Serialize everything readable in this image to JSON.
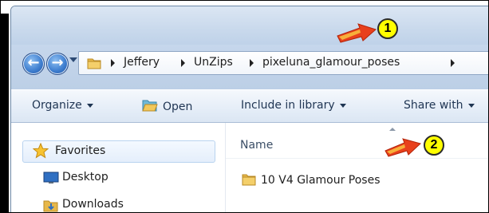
{
  "breadcrumb": {
    "items": [
      "Jeffery",
      "UnZips",
      "pixeluna_glamour_poses"
    ]
  },
  "toolbar": {
    "organize_label": "Organize",
    "open_label": "Open",
    "include_label": "Include in library",
    "share_label": "Share with"
  },
  "nav_pane": {
    "favorites_label": "Favorites",
    "items": [
      "Desktop",
      "Downloads"
    ]
  },
  "file_list": {
    "column_name": "Name",
    "rows": [
      "10 V4 Glamour Poses"
    ]
  },
  "annotations": {
    "badge1": "1",
    "badge2": "2",
    "badge_color": "#ffff00",
    "arrow_color": "#e8401c"
  }
}
